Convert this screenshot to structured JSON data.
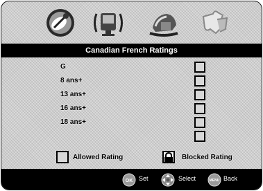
{
  "menu_icons": [
    {
      "name": "satellite-dish-icon"
    },
    {
      "name": "tv-speaker-icon"
    },
    {
      "name": "parental-lock-icon"
    },
    {
      "name": "puzzle-icon"
    }
  ],
  "title": "Canadian French Ratings",
  "ratings": [
    {
      "label": "G",
      "blocked": false
    },
    {
      "label": "8 ans+",
      "blocked": false
    },
    {
      "label": "13 ans+",
      "blocked": false
    },
    {
      "label": "16 ans+",
      "blocked": false
    },
    {
      "label": "18 ans+",
      "blocked": false
    },
    {
      "label": "",
      "blocked": false
    }
  ],
  "legend": {
    "allowed_label": "Allowed Rating",
    "blocked_label": "Blocked Rating"
  },
  "controls": {
    "ok_icon_text": "OK",
    "set_label": "Set",
    "select_label": "Select",
    "menu_icon_text": "MENU",
    "back_label": "Back"
  },
  "colors": {
    "bar": "#000000",
    "background": "#cfcfcf"
  }
}
